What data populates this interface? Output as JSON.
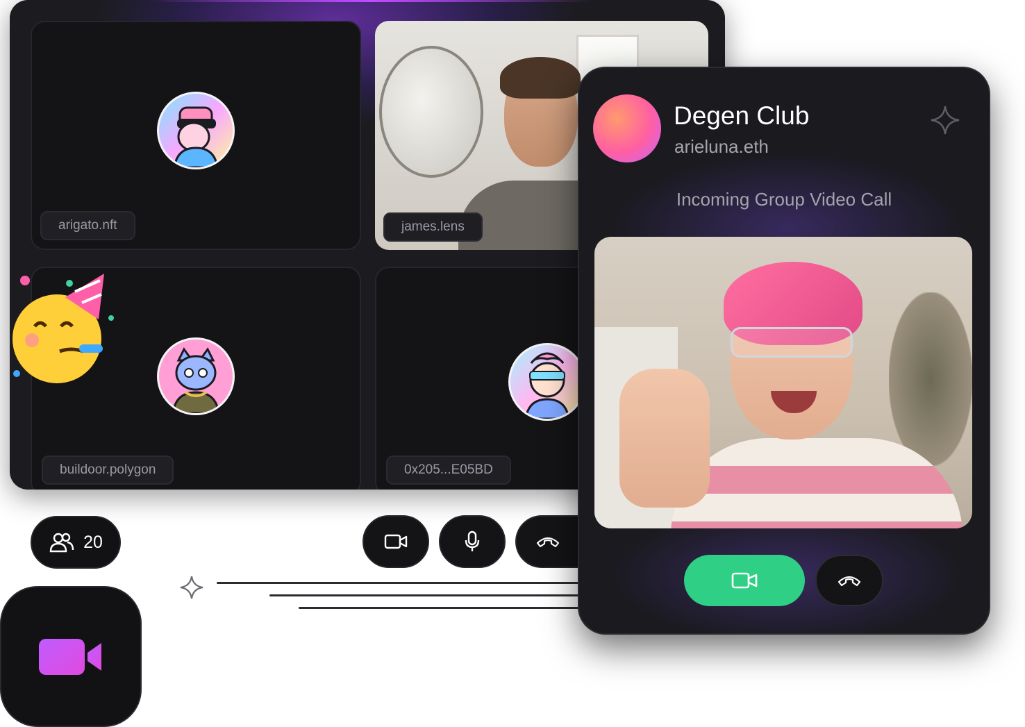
{
  "call_grid": {
    "tiles": [
      {
        "name": "arigato.nft"
      },
      {
        "name": "james.lens"
      },
      {
        "name": "buildoor.polygon"
      },
      {
        "name": "0x205...E05BD"
      }
    ]
  },
  "controls": {
    "participant_count": "20"
  },
  "incoming_call": {
    "group_name": "Degen Club",
    "caller": "arieluna.eth",
    "status": "Incoming Group Video Call"
  },
  "colors": {
    "accept": "#2fcf86",
    "accent_purple": "#c04cff",
    "background": "#1c1c20"
  },
  "icons": [
    "users-icon",
    "video-camera-icon",
    "microphone-icon",
    "hang-up-icon",
    "sparkle-icon",
    "party-emoji",
    "app-video-icon"
  ]
}
